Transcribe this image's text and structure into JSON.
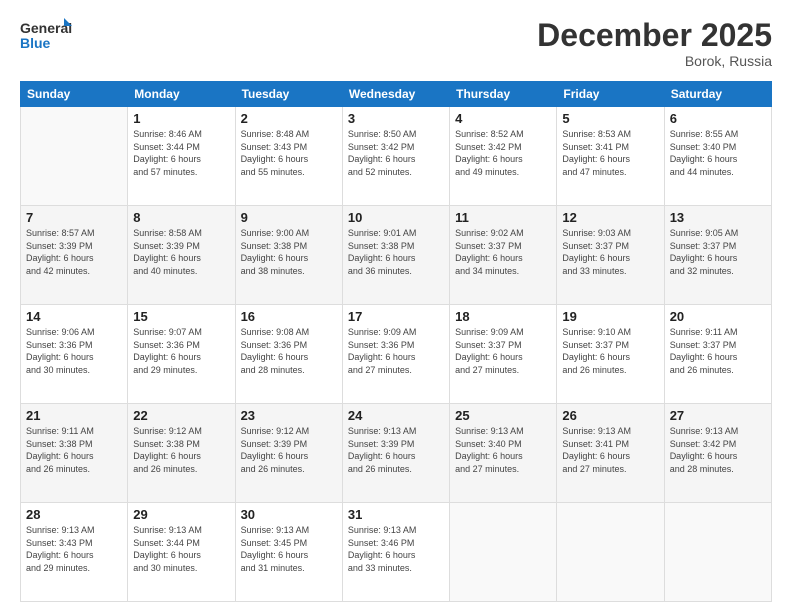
{
  "header": {
    "logo_line1": "General",
    "logo_line2": "Blue",
    "month": "December 2025",
    "location": "Borok, Russia"
  },
  "weekdays": [
    "Sunday",
    "Monday",
    "Tuesday",
    "Wednesday",
    "Thursday",
    "Friday",
    "Saturday"
  ],
  "weeks": [
    [
      {
        "day": "",
        "text": ""
      },
      {
        "day": "1",
        "text": "Sunrise: 8:46 AM\nSunset: 3:44 PM\nDaylight: 6 hours\nand 57 minutes."
      },
      {
        "day": "2",
        "text": "Sunrise: 8:48 AM\nSunset: 3:43 PM\nDaylight: 6 hours\nand 55 minutes."
      },
      {
        "day": "3",
        "text": "Sunrise: 8:50 AM\nSunset: 3:42 PM\nDaylight: 6 hours\nand 52 minutes."
      },
      {
        "day": "4",
        "text": "Sunrise: 8:52 AM\nSunset: 3:42 PM\nDaylight: 6 hours\nand 49 minutes."
      },
      {
        "day": "5",
        "text": "Sunrise: 8:53 AM\nSunset: 3:41 PM\nDaylight: 6 hours\nand 47 minutes."
      },
      {
        "day": "6",
        "text": "Sunrise: 8:55 AM\nSunset: 3:40 PM\nDaylight: 6 hours\nand 44 minutes."
      }
    ],
    [
      {
        "day": "7",
        "text": "Sunrise: 8:57 AM\nSunset: 3:39 PM\nDaylight: 6 hours\nand 42 minutes."
      },
      {
        "day": "8",
        "text": "Sunrise: 8:58 AM\nSunset: 3:39 PM\nDaylight: 6 hours\nand 40 minutes."
      },
      {
        "day": "9",
        "text": "Sunrise: 9:00 AM\nSunset: 3:38 PM\nDaylight: 6 hours\nand 38 minutes."
      },
      {
        "day": "10",
        "text": "Sunrise: 9:01 AM\nSunset: 3:38 PM\nDaylight: 6 hours\nand 36 minutes."
      },
      {
        "day": "11",
        "text": "Sunrise: 9:02 AM\nSunset: 3:37 PM\nDaylight: 6 hours\nand 34 minutes."
      },
      {
        "day": "12",
        "text": "Sunrise: 9:03 AM\nSunset: 3:37 PM\nDaylight: 6 hours\nand 33 minutes."
      },
      {
        "day": "13",
        "text": "Sunrise: 9:05 AM\nSunset: 3:37 PM\nDaylight: 6 hours\nand 32 minutes."
      }
    ],
    [
      {
        "day": "14",
        "text": "Sunrise: 9:06 AM\nSunset: 3:36 PM\nDaylight: 6 hours\nand 30 minutes."
      },
      {
        "day": "15",
        "text": "Sunrise: 9:07 AM\nSunset: 3:36 PM\nDaylight: 6 hours\nand 29 minutes."
      },
      {
        "day": "16",
        "text": "Sunrise: 9:08 AM\nSunset: 3:36 PM\nDaylight: 6 hours\nand 28 minutes."
      },
      {
        "day": "17",
        "text": "Sunrise: 9:09 AM\nSunset: 3:36 PM\nDaylight: 6 hours\nand 27 minutes."
      },
      {
        "day": "18",
        "text": "Sunrise: 9:09 AM\nSunset: 3:37 PM\nDaylight: 6 hours\nand 27 minutes."
      },
      {
        "day": "19",
        "text": "Sunrise: 9:10 AM\nSunset: 3:37 PM\nDaylight: 6 hours\nand 26 minutes."
      },
      {
        "day": "20",
        "text": "Sunrise: 9:11 AM\nSunset: 3:37 PM\nDaylight: 6 hours\nand 26 minutes."
      }
    ],
    [
      {
        "day": "21",
        "text": "Sunrise: 9:11 AM\nSunset: 3:38 PM\nDaylight: 6 hours\nand 26 minutes."
      },
      {
        "day": "22",
        "text": "Sunrise: 9:12 AM\nSunset: 3:38 PM\nDaylight: 6 hours\nand 26 minutes."
      },
      {
        "day": "23",
        "text": "Sunrise: 9:12 AM\nSunset: 3:39 PM\nDaylight: 6 hours\nand 26 minutes."
      },
      {
        "day": "24",
        "text": "Sunrise: 9:13 AM\nSunset: 3:39 PM\nDaylight: 6 hours\nand 26 minutes."
      },
      {
        "day": "25",
        "text": "Sunrise: 9:13 AM\nSunset: 3:40 PM\nDaylight: 6 hours\nand 27 minutes."
      },
      {
        "day": "26",
        "text": "Sunrise: 9:13 AM\nSunset: 3:41 PM\nDaylight: 6 hours\nand 27 minutes."
      },
      {
        "day": "27",
        "text": "Sunrise: 9:13 AM\nSunset: 3:42 PM\nDaylight: 6 hours\nand 28 minutes."
      }
    ],
    [
      {
        "day": "28",
        "text": "Sunrise: 9:13 AM\nSunset: 3:43 PM\nDaylight: 6 hours\nand 29 minutes."
      },
      {
        "day": "29",
        "text": "Sunrise: 9:13 AM\nSunset: 3:44 PM\nDaylight: 6 hours\nand 30 minutes."
      },
      {
        "day": "30",
        "text": "Sunrise: 9:13 AM\nSunset: 3:45 PM\nDaylight: 6 hours\nand 31 minutes."
      },
      {
        "day": "31",
        "text": "Sunrise: 9:13 AM\nSunset: 3:46 PM\nDaylight: 6 hours\nand 33 minutes."
      },
      {
        "day": "",
        "text": ""
      },
      {
        "day": "",
        "text": ""
      },
      {
        "day": "",
        "text": ""
      }
    ]
  ]
}
